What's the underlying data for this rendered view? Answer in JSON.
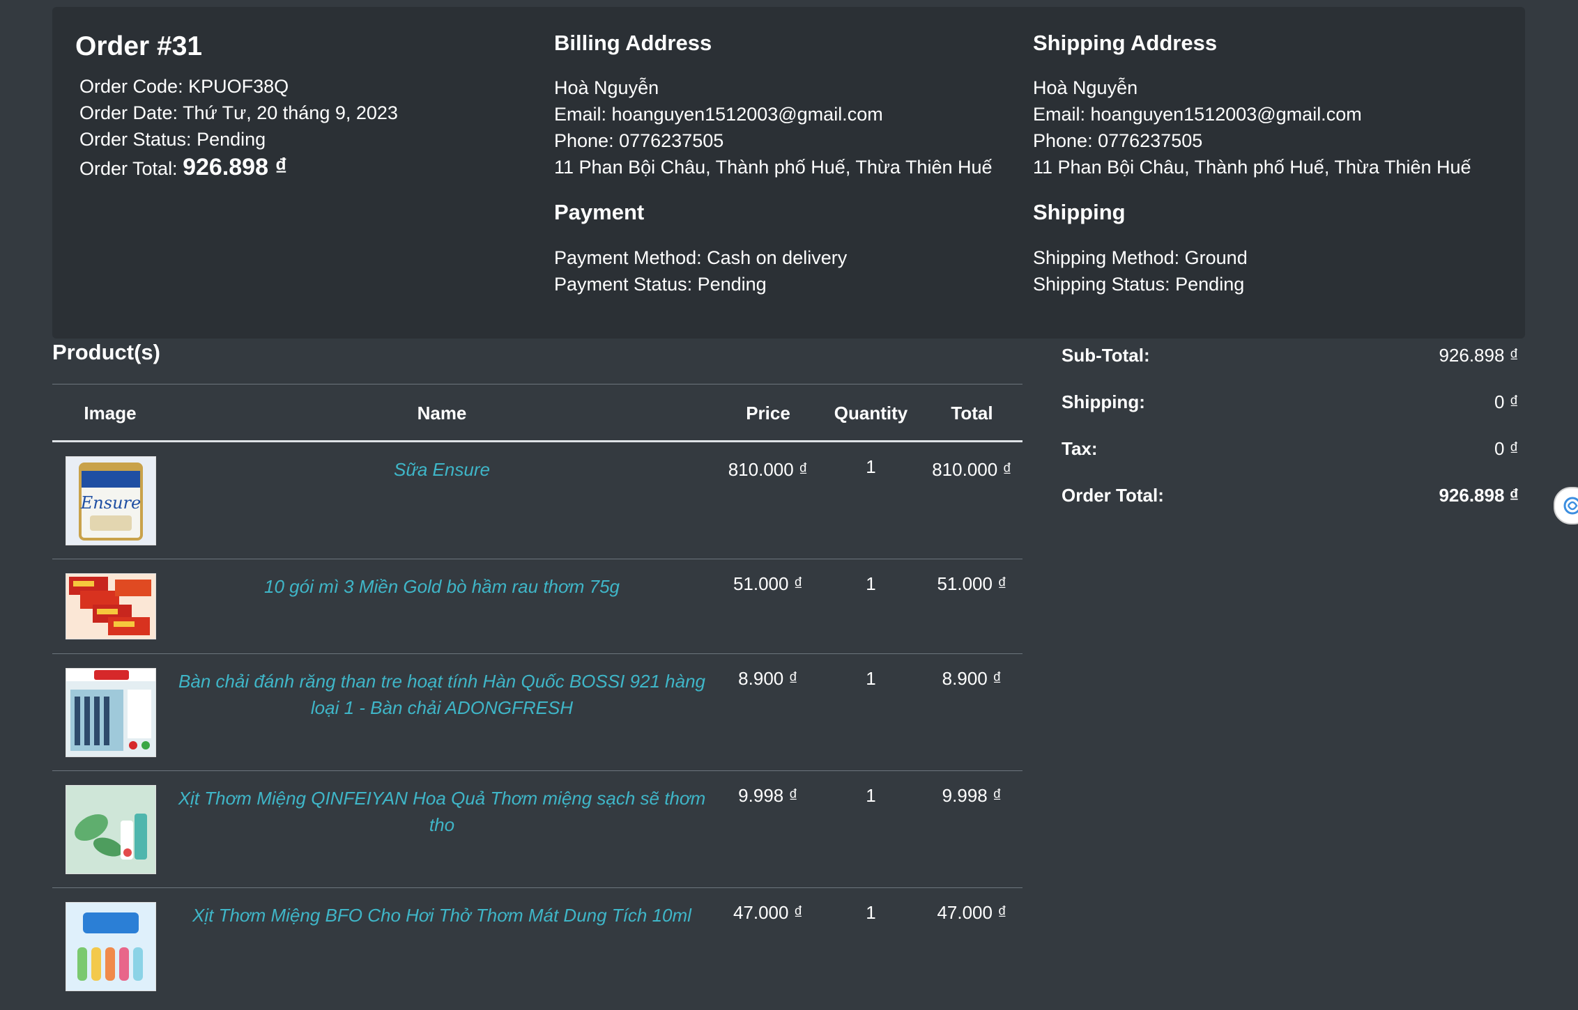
{
  "order": {
    "title": "Order #31",
    "code": "Order Code: KPUOF38Q",
    "date": "Order Date: Thứ Tư, 20 tháng 9, 2023",
    "status": "Order Status: Pending",
    "total_label": "Order Total:",
    "total_value": "926.898 ₫"
  },
  "billing": {
    "title": "Billing Address",
    "name": "Hoà Nguyễn",
    "email": "Email: hoanguyen1512003@gmail.com",
    "phone": "Phone: 0776237505",
    "address": "11 Phan Bội Châu, Thành phố Huế, Thừa Thiên Huế"
  },
  "shipping_address": {
    "title": "Shipping Address",
    "name": "Hoà Nguyễn",
    "email": "Email: hoanguyen1512003@gmail.com",
    "phone": "Phone: 0776237505",
    "address": "11 Phan Bội Châu, Thành phố Huế, Thừa Thiên Huế"
  },
  "payment": {
    "title": "Payment",
    "method": "Payment Method: Cash on delivery",
    "status": "Payment Status: Pending"
  },
  "shipping": {
    "title": "Shipping",
    "method": "Shipping Method: Ground",
    "status": "Shipping Status: Pending"
  },
  "products": {
    "title": "Product(s)",
    "headers": {
      "image": "Image",
      "name": "Name",
      "price": "Price",
      "quantity": "Quantity",
      "total": "Total"
    },
    "rows": [
      {
        "name": "Sữa Ensure",
        "price": "810.000 ₫",
        "quantity": "1",
        "total": "810.000 ₫",
        "image": "ensure-milk-can"
      },
      {
        "name": "10 gói mì 3 Miền Gold bò hầm rau thơm 75g",
        "price": "51.000 ₫",
        "quantity": "1",
        "total": "51.000 ₫",
        "image": "noodle-packs"
      },
      {
        "name": "Bàn chải đánh răng than tre hoạt tính Hàn Quốc BOSSI 921 hàng loại 1 - Bàn chải ADONGFRESH",
        "price": "8.900 ₫",
        "quantity": "1",
        "total": "8.900 ₫",
        "image": "toothbrush-pack"
      },
      {
        "name": "Xịt Thơm Miệng QINFEIYAN Hoa Quả Thơm miệng sạch sẽ thơm tho",
        "price": "9.998 ₫",
        "quantity": "1",
        "total": "9.998 ₫",
        "image": "mouth-spray-green"
      },
      {
        "name": "Xịt Thơm Miệng BFO Cho Hơi Thở Thơm Mát Dung Tích 10ml",
        "price": "47.000 ₫",
        "quantity": "1",
        "total": "47.000 ₫",
        "image": "mouth-spray-colorful"
      }
    ]
  },
  "summary": {
    "subtotal_label": "Sub-Total:",
    "subtotal": "926.898 ₫",
    "shipping_label": "Shipping:",
    "shipping": "0 ₫",
    "tax_label": "Tax:",
    "tax": "0 ₫",
    "total_label": "Order Total:",
    "total": "926.898 ₫"
  },
  "colors": {
    "background": "#343a40",
    "card": "#2b3035",
    "link": "#3fb6c8"
  },
  "icons": {
    "floating_button": "assistant-swirl-icon"
  }
}
